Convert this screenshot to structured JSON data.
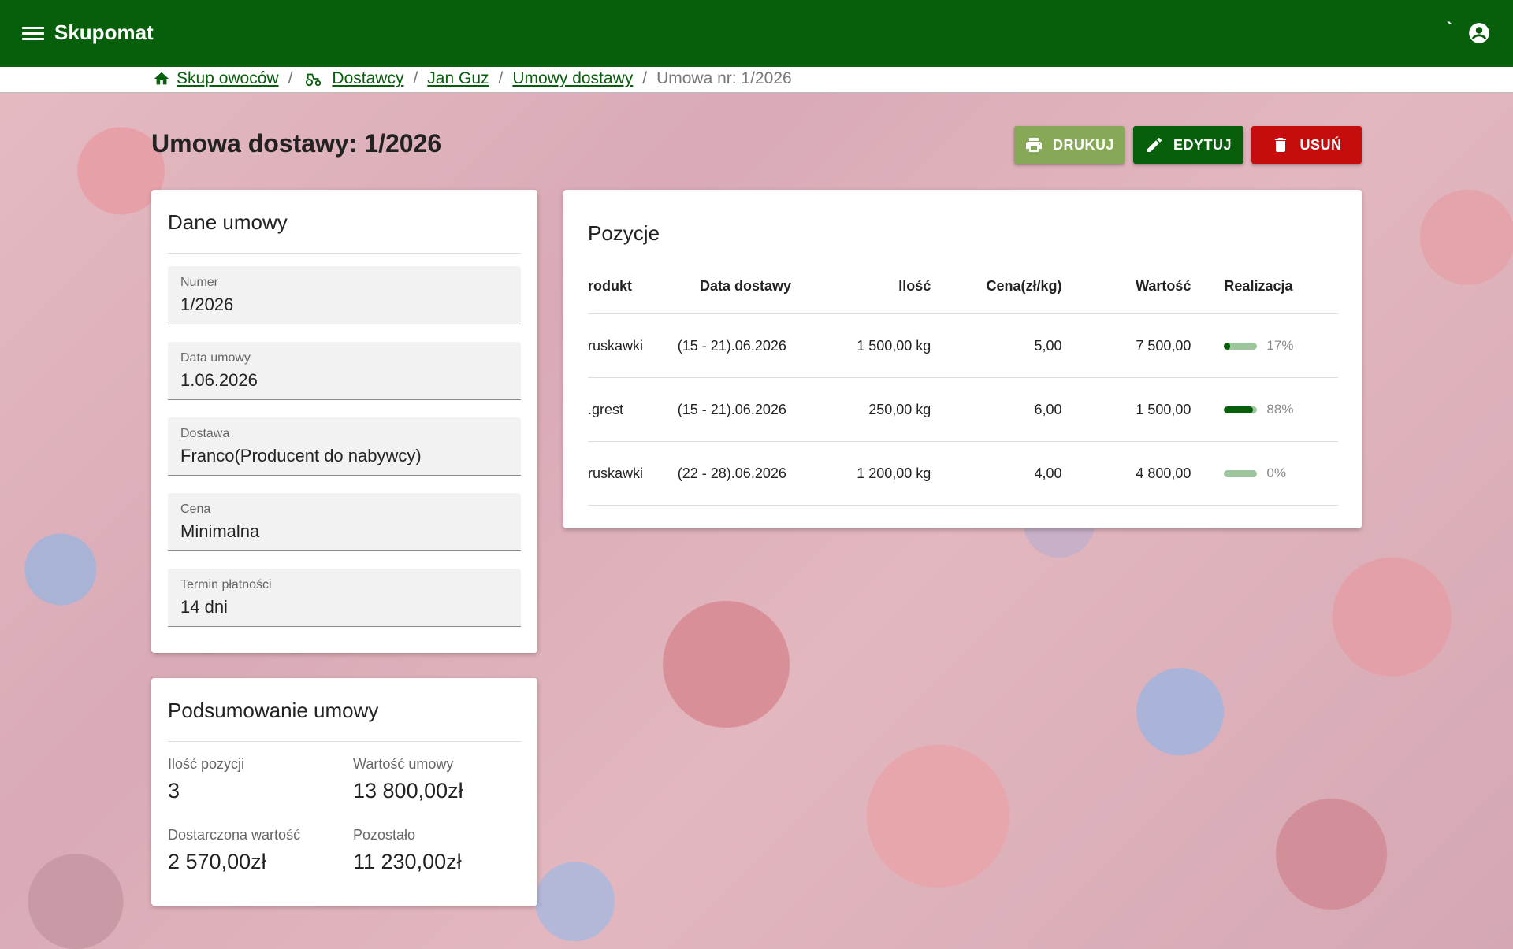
{
  "app": {
    "title": "Skupomat",
    "tick": "`"
  },
  "breadcrumb": {
    "items": [
      "Skup owoców",
      "Dostawcy",
      "Jan Guz",
      "Umowy dostawy"
    ],
    "current": "Umowa nr: 1/2026",
    "separator": "/"
  },
  "page": {
    "title": "Umowa dostawy: 1/2026"
  },
  "actions": {
    "print": "DRUKUJ",
    "edit": "EDYTUJ",
    "delete": "USUŃ"
  },
  "details": {
    "title": "Dane umowy",
    "fields": [
      {
        "label": "Numer",
        "value": "1/2026"
      },
      {
        "label": "Data umowy",
        "value": "1.06.2026"
      },
      {
        "label": "Dostawa",
        "value": "Franco(Producent do nabywcy)"
      },
      {
        "label": "Cena",
        "value": "Minimalna"
      },
      {
        "label": "Termin płatności",
        "value": "14 dni"
      }
    ]
  },
  "summary": {
    "title": "Podsumowanie umowy",
    "items": [
      {
        "label": "Ilość pozycji",
        "value": "3"
      },
      {
        "label": "Wartość umowy",
        "value": "13 800,00zł"
      },
      {
        "label": "Dostarczona wartość",
        "value": "2 570,00zł"
      },
      {
        "label": "Pozostało",
        "value": "11 230,00zł"
      }
    ]
  },
  "positions": {
    "title": "Pozycje",
    "headers": [
      "rodukt",
      "Data dostawy",
      "Ilość",
      "Cena(zł/kg)",
      "Wartość",
      "Realizacja"
    ],
    "rows": [
      {
        "product": "ruskawki",
        "date": "(15 - 21).06.2026",
        "qty": "1 500,00 kg",
        "price": "5,00",
        "value": "7 500,00",
        "realization": 17,
        "realization_label": "17%"
      },
      {
        "product": ".grest",
        "date": "(15 - 21).06.2026",
        "qty": "250,00 kg",
        "price": "6,00",
        "value": "1 500,00",
        "realization": 88,
        "realization_label": "88%"
      },
      {
        "product": "ruskawki",
        "date": "(22 - 28).06.2026",
        "qty": "1 200,00 kg",
        "price": "4,00",
        "value": "4 800,00",
        "realization": 0,
        "realization_label": "0%"
      }
    ]
  },
  "colors": {
    "primary": "#075e0b",
    "print": "#87a957",
    "delete": "#c50d0d",
    "progress_track": "#9cc49d"
  }
}
